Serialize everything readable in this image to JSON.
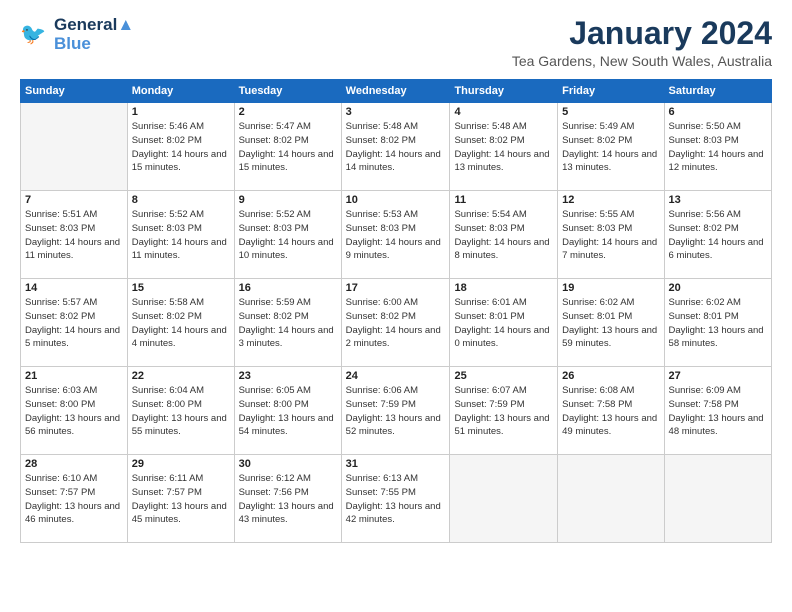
{
  "header": {
    "logo_line1": "General",
    "logo_line2": "Blue",
    "month_title": "January 2024",
    "location": "Tea Gardens, New South Wales, Australia"
  },
  "days_of_week": [
    "Sunday",
    "Monday",
    "Tuesday",
    "Wednesday",
    "Thursday",
    "Friday",
    "Saturday"
  ],
  "weeks": [
    [
      {
        "day": "",
        "empty": true
      },
      {
        "day": "1",
        "sunrise": "5:46 AM",
        "sunset": "8:02 PM",
        "daylight": "14 hours and 15 minutes."
      },
      {
        "day": "2",
        "sunrise": "5:47 AM",
        "sunset": "8:02 PM",
        "daylight": "14 hours and 15 minutes."
      },
      {
        "day": "3",
        "sunrise": "5:48 AM",
        "sunset": "8:02 PM",
        "daylight": "14 hours and 14 minutes."
      },
      {
        "day": "4",
        "sunrise": "5:48 AM",
        "sunset": "8:02 PM",
        "daylight": "14 hours and 13 minutes."
      },
      {
        "day": "5",
        "sunrise": "5:49 AM",
        "sunset": "8:02 PM",
        "daylight": "14 hours and 13 minutes."
      },
      {
        "day": "6",
        "sunrise": "5:50 AM",
        "sunset": "8:03 PM",
        "daylight": "14 hours and 12 minutes."
      }
    ],
    [
      {
        "day": "7",
        "sunrise": "5:51 AM",
        "sunset": "8:03 PM",
        "daylight": "14 hours and 11 minutes."
      },
      {
        "day": "8",
        "sunrise": "5:52 AM",
        "sunset": "8:03 PM",
        "daylight": "14 hours and 11 minutes."
      },
      {
        "day": "9",
        "sunrise": "5:52 AM",
        "sunset": "8:03 PM",
        "daylight": "14 hours and 10 minutes."
      },
      {
        "day": "10",
        "sunrise": "5:53 AM",
        "sunset": "8:03 PM",
        "daylight": "14 hours and 9 minutes."
      },
      {
        "day": "11",
        "sunrise": "5:54 AM",
        "sunset": "8:03 PM",
        "daylight": "14 hours and 8 minutes."
      },
      {
        "day": "12",
        "sunrise": "5:55 AM",
        "sunset": "8:03 PM",
        "daylight": "14 hours and 7 minutes."
      },
      {
        "day": "13",
        "sunrise": "5:56 AM",
        "sunset": "8:02 PM",
        "daylight": "14 hours and 6 minutes."
      }
    ],
    [
      {
        "day": "14",
        "sunrise": "5:57 AM",
        "sunset": "8:02 PM",
        "daylight": "14 hours and 5 minutes."
      },
      {
        "day": "15",
        "sunrise": "5:58 AM",
        "sunset": "8:02 PM",
        "daylight": "14 hours and 4 minutes."
      },
      {
        "day": "16",
        "sunrise": "5:59 AM",
        "sunset": "8:02 PM",
        "daylight": "14 hours and 3 minutes."
      },
      {
        "day": "17",
        "sunrise": "6:00 AM",
        "sunset": "8:02 PM",
        "daylight": "14 hours and 2 minutes."
      },
      {
        "day": "18",
        "sunrise": "6:01 AM",
        "sunset": "8:01 PM",
        "daylight": "14 hours and 0 minutes."
      },
      {
        "day": "19",
        "sunrise": "6:02 AM",
        "sunset": "8:01 PM",
        "daylight": "13 hours and 59 minutes."
      },
      {
        "day": "20",
        "sunrise": "6:02 AM",
        "sunset": "8:01 PM",
        "daylight": "13 hours and 58 minutes."
      }
    ],
    [
      {
        "day": "21",
        "sunrise": "6:03 AM",
        "sunset": "8:00 PM",
        "daylight": "13 hours and 56 minutes."
      },
      {
        "day": "22",
        "sunrise": "6:04 AM",
        "sunset": "8:00 PM",
        "daylight": "13 hours and 55 minutes."
      },
      {
        "day": "23",
        "sunrise": "6:05 AM",
        "sunset": "8:00 PM",
        "daylight": "13 hours and 54 minutes."
      },
      {
        "day": "24",
        "sunrise": "6:06 AM",
        "sunset": "7:59 PM",
        "daylight": "13 hours and 52 minutes."
      },
      {
        "day": "25",
        "sunrise": "6:07 AM",
        "sunset": "7:59 PM",
        "daylight": "13 hours and 51 minutes."
      },
      {
        "day": "26",
        "sunrise": "6:08 AM",
        "sunset": "7:58 PM",
        "daylight": "13 hours and 49 minutes."
      },
      {
        "day": "27",
        "sunrise": "6:09 AM",
        "sunset": "7:58 PM",
        "daylight": "13 hours and 48 minutes."
      }
    ],
    [
      {
        "day": "28",
        "sunrise": "6:10 AM",
        "sunset": "7:57 PM",
        "daylight": "13 hours and 46 minutes."
      },
      {
        "day": "29",
        "sunrise": "6:11 AM",
        "sunset": "7:57 PM",
        "daylight": "13 hours and 45 minutes."
      },
      {
        "day": "30",
        "sunrise": "6:12 AM",
        "sunset": "7:56 PM",
        "daylight": "13 hours and 43 minutes."
      },
      {
        "day": "31",
        "sunrise": "6:13 AM",
        "sunset": "7:55 PM",
        "daylight": "13 hours and 42 minutes."
      },
      {
        "day": "",
        "empty": true
      },
      {
        "day": "",
        "empty": true
      },
      {
        "day": "",
        "empty": true
      }
    ]
  ]
}
